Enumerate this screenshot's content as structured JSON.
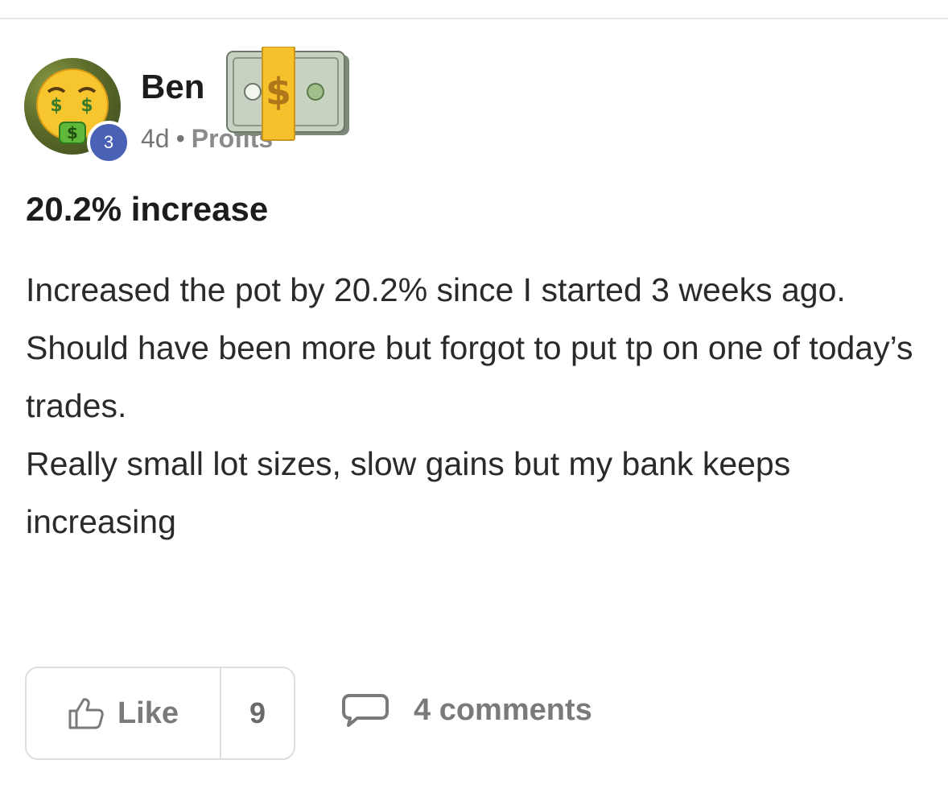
{
  "post": {
    "author": "Ben",
    "author_level": "3",
    "age": "4d",
    "separator": "•",
    "category": "Profits",
    "title": "20.2% increase",
    "body": [
      "Increased the pot by 20.2% since I started 3 weeks ago.",
      "Should have been more but forgot to put tp on one of today’s trades.",
      "Really small lot sizes, slow gains but my bank keeps increasing"
    ],
    "avatar_icon": "money-mouth-face-emoji",
    "sticker_icon": "money-with-wings-emoji"
  },
  "actions": {
    "like_label": "Like",
    "like_count": "9",
    "comments_label": "4 comments"
  }
}
